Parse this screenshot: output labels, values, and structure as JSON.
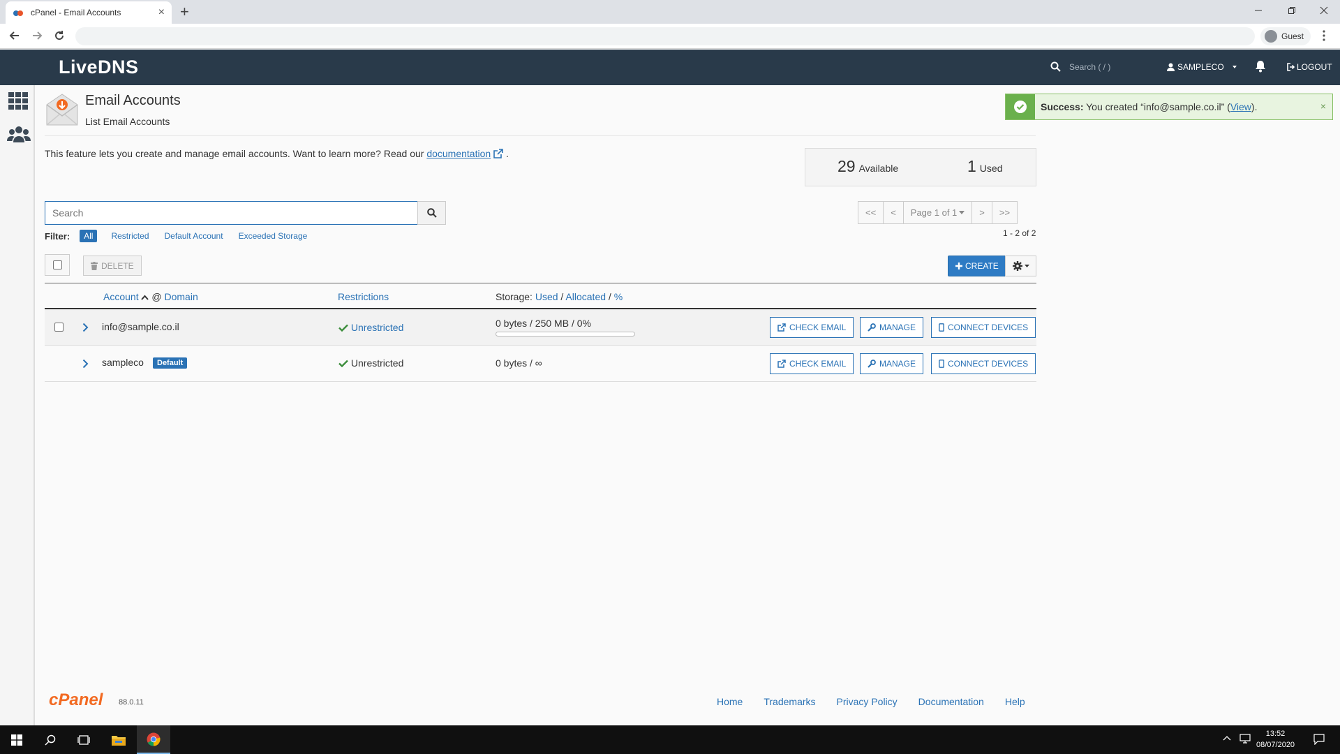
{
  "browser": {
    "tab_title": "cPanel - Email Accounts",
    "tab_close": "×",
    "new_tab": "+",
    "profile": "Guest"
  },
  "header": {
    "brand": "LiveDNS",
    "search_placeholder": "Search ( / )",
    "user": "SAMPLECO",
    "logout": "LOGOUT"
  },
  "page": {
    "title": "Email Accounts",
    "subtitle": "List Email Accounts",
    "intro": "This feature lets you create and manage email accounts. Want to learn more? Read our",
    "doc_link": "documentation",
    "intro_end": "."
  },
  "alert": {
    "strong": "Success:",
    "text_before": "You created “info@sample.co.il” (",
    "link": "View",
    "text_after": ").",
    "close": "×"
  },
  "stats": {
    "available_num": "29",
    "available_label": "Available",
    "used_num": "1",
    "used_label": "Used"
  },
  "search": {
    "placeholder": "Search"
  },
  "pager": {
    "first": "<<",
    "prev": "<",
    "page": "Page 1 of 1",
    "next": ">",
    "last": ">>",
    "range": "1 - 2 of 2"
  },
  "filter": {
    "label": "Filter:",
    "items": [
      "All",
      "Restricted",
      "Default Account",
      "Exceeded Storage"
    ]
  },
  "toolbar": {
    "delete": "DELETE",
    "create": "CREATE"
  },
  "table": {
    "col_account": "Account",
    "col_at": "@",
    "col_domain": "Domain",
    "col_restrictions": "Restrictions",
    "col_storage": "Storage:",
    "col_used": "Used",
    "col_allocated": "Allocated",
    "col_pct": "%",
    "slash": "/",
    "rows": [
      {
        "account": "info@sample.co.il",
        "badge": "",
        "restriction": "Unrestricted",
        "storage": "0 bytes / 250 MB / 0%",
        "usage_fraction": 0
      },
      {
        "account": "sampleco",
        "badge": "Default",
        "restriction": "Unrestricted",
        "storage": "0 bytes / ∞"
      }
    ],
    "btn_check": "CHECK EMAIL",
    "btn_manage": "MANAGE",
    "btn_connect": "CONNECT DEVICES"
  },
  "footer": {
    "logo": "cPanel",
    "version": "88.0.11",
    "links": [
      "Home",
      "Trademarks",
      "Privacy Policy",
      "Documentation",
      "Help"
    ]
  },
  "taskbar": {
    "time": "13:52",
    "date": "08/07/2020"
  },
  "colors": {
    "header_bg": "#293a4a",
    "accent": "#2a72b5",
    "success": "#6ab04c",
    "cpanel_orange": "#f26a22"
  }
}
